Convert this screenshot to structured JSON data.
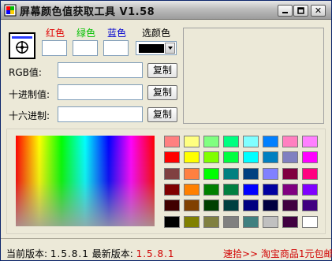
{
  "window": {
    "title": "屏幕颜色值获取工具 V1.58",
    "minimize_glyph": "_",
    "maximize_glyph": "□",
    "close_glyph": "✕"
  },
  "labels": {
    "red": "红色",
    "green": "绿色",
    "blue": "蓝色",
    "pick_color": "选颜色",
    "rgb": "RGB值:",
    "decimal": "十进制值:",
    "hex": "十六进制:"
  },
  "label_colors": {
    "red": "#e00000",
    "green": "#00c000",
    "blue": "#0000d0"
  },
  "fields": {
    "red_value": "",
    "green_value": "",
    "blue_value": "",
    "rgb_value": "",
    "decimal_value": "",
    "hex_value": ""
  },
  "buttons": {
    "copy_rgb": "复制",
    "copy_decimal": "复制",
    "copy_hex": "复制"
  },
  "icons": {
    "eyedropper": "crosshair-target-icon",
    "app": "color-picker-app-icon",
    "dropdown": "chevron-down-icon"
  },
  "selected_color": "#000000",
  "palette": [
    [
      "#ff8080",
      "#ffff80",
      "#80ff80",
      "#00ff80",
      "#80ffff",
      "#0080ff",
      "#ff80c0",
      "#ff80ff"
    ],
    [
      "#ff0000",
      "#ffff00",
      "#80ff00",
      "#00ff40",
      "#00ffff",
      "#0080c0",
      "#8080c0",
      "#ff00ff"
    ],
    [
      "#804040",
      "#ff8040",
      "#00ff00",
      "#008080",
      "#004080",
      "#8080ff",
      "#800040",
      "#ff0080"
    ],
    [
      "#800000",
      "#ff8000",
      "#008000",
      "#008040",
      "#0000ff",
      "#0000a0",
      "#800080",
      "#8000ff"
    ],
    [
      "#400000",
      "#804000",
      "#004000",
      "#004040",
      "#000080",
      "#000040",
      "#400040",
      "#400080"
    ],
    [
      "#000000",
      "#808000",
      "#808040",
      "#808080",
      "#408080",
      "#c0c0c0",
      "#400040",
      "#ffffff"
    ]
  ],
  "status": {
    "current_label": "当前版本:",
    "current_version": "1.5.8.1",
    "latest_label": "最新版本:",
    "latest_version": "1.5.8.1",
    "promo": "速拾>> 淘宝商品1元包邮"
  }
}
